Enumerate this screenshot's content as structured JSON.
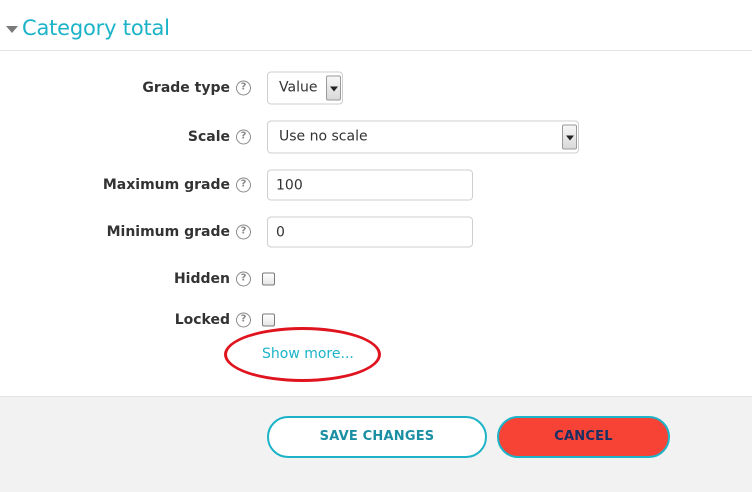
{
  "section": {
    "title": "Category total",
    "collapse_icon": "triangle-down-icon"
  },
  "form": {
    "grade_type": {
      "label": "Grade type",
      "value": "Value"
    },
    "scale": {
      "label": "Scale",
      "value": "Use no scale"
    },
    "maximum_grade": {
      "label": "Maximum grade",
      "value": "100"
    },
    "minimum_grade": {
      "label": "Minimum grade",
      "value": "0"
    },
    "hidden": {
      "label": "Hidden",
      "checked": false
    },
    "locked": {
      "label": "Locked",
      "checked": false
    },
    "help_glyph": "?",
    "show_more": "Show more..."
  },
  "buttons": {
    "save": "SAVE CHANGES",
    "cancel": "CANCEL"
  },
  "colors": {
    "accent": "#1cb3c8",
    "cancel_bg": "#f74336",
    "highlight": "#e0141e"
  }
}
